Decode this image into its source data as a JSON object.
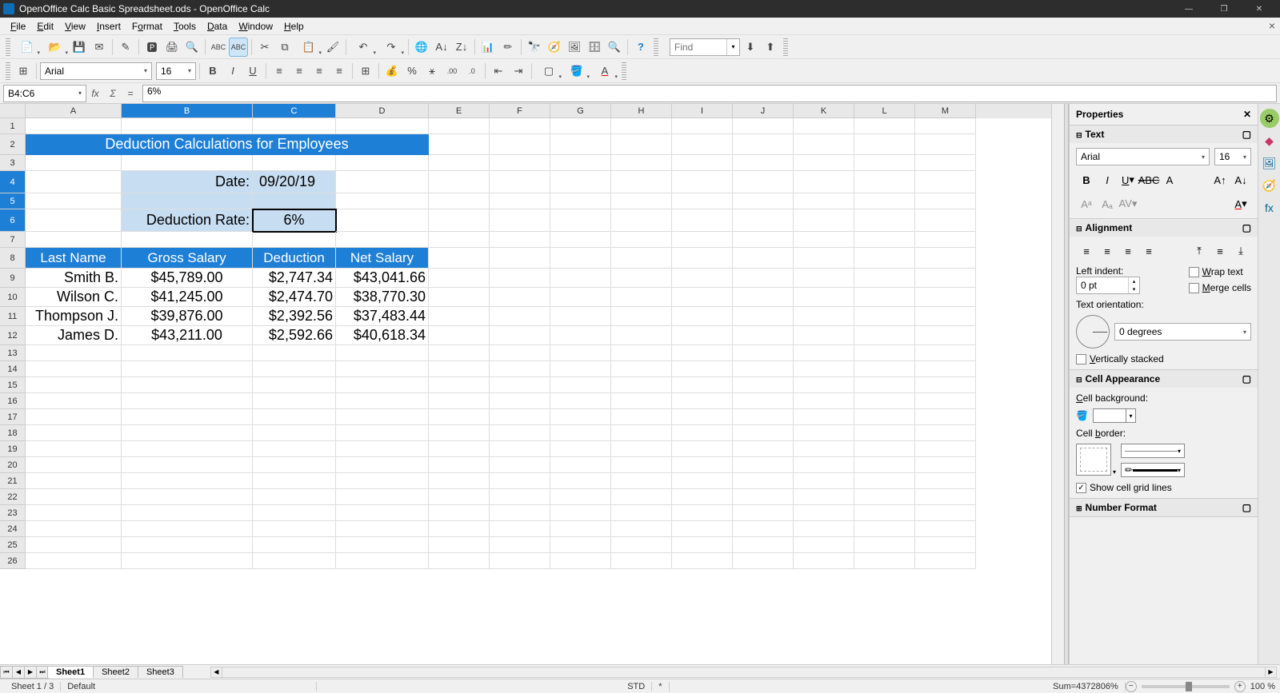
{
  "window": {
    "title": "OpenOffice Calc Basic Spreadsheet.ods - OpenOffice Calc"
  },
  "menu": {
    "file": "File",
    "edit": "Edit",
    "view": "View",
    "insert": "Insert",
    "format": "Format",
    "tools": "Tools",
    "data": "Data",
    "window": "Window",
    "help": "Help"
  },
  "find": {
    "placeholder": "Find"
  },
  "format_bar": {
    "font": "Arial",
    "size": "16"
  },
  "name_box": "B4:C6",
  "formula": "6%",
  "columns": [
    "A",
    "B",
    "C",
    "D",
    "E",
    "F",
    "G",
    "H",
    "I",
    "J",
    "K",
    "L",
    "M"
  ],
  "sel_cols": [
    "B",
    "C"
  ],
  "sel_rows": [
    4,
    5,
    6
  ],
  "sheet": {
    "r2": {
      "title": "Deduction Calculations for Employees"
    },
    "r4": {
      "b": "Date:",
      "c": "09/20/19"
    },
    "r6": {
      "b": "Deduction Rate:",
      "c": "6%"
    },
    "r8": {
      "a": "Last Name",
      "b": "Gross Salary",
      "c": "Deduction",
      "d": "Net Salary"
    },
    "r9": {
      "a": "Smith B.",
      "b": "$45,789.00",
      "c": "$2,747.34",
      "d": "$43,041.66"
    },
    "r10": {
      "a": "Wilson C.",
      "b": "$41,245.00",
      "c": "$2,474.70",
      "d": "$38,770.30"
    },
    "r11": {
      "a": "Thompson J.",
      "b": "$39,876.00",
      "c": "$2,392.56",
      "d": "$37,483.44"
    },
    "r12": {
      "a": "James D.",
      "b": "$43,211.00",
      "c": "$2,592.66",
      "d": "$40,618.34"
    }
  },
  "tabs": {
    "s1": "Sheet1",
    "s2": "Sheet2",
    "s3": "Sheet3"
  },
  "sidebar": {
    "title": "Properties",
    "text": {
      "head": "Text",
      "font": "Arial",
      "size": "16"
    },
    "align": {
      "head": "Alignment",
      "indent_label": "Left indent:",
      "indent": "0 pt",
      "wrap": "Wrap text",
      "merge": "Merge cells",
      "orient_label": "Text orientation:",
      "degrees": "0 degrees",
      "vert": "Vertically stacked"
    },
    "appearance": {
      "head": "Cell Appearance",
      "bg_label": "Cell background:",
      "border_label": "Cell border:",
      "show_grid": "Show cell grid lines"
    },
    "numfmt": {
      "head": "Number Format"
    }
  },
  "status": {
    "sheet": "Sheet 1 / 3",
    "style": "Default",
    "mode": "STD",
    "mod": "*",
    "sum": "Sum=4372806%",
    "zoom": "100 %"
  }
}
